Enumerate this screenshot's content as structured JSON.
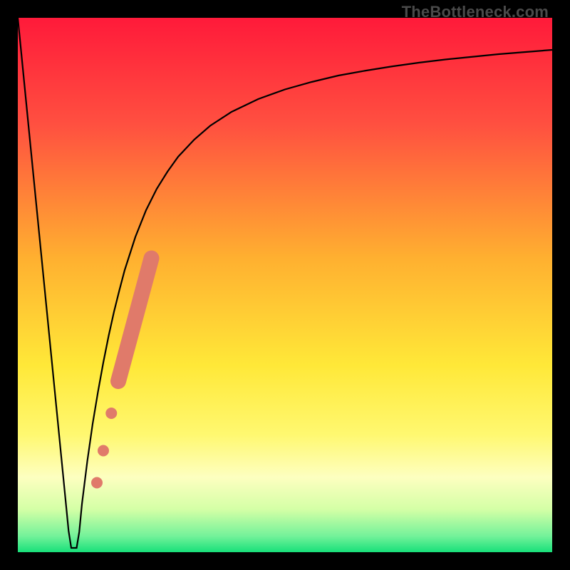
{
  "watermark": "TheBottleneck.com",
  "colors": {
    "frame": "#000000",
    "curve": "#000000",
    "marker_fill": "#e07a6a",
    "marker_stroke": "#cf6b5c",
    "gradient_stops": [
      {
        "offset": 0.0,
        "color": "#ff1a3a"
      },
      {
        "offset": 0.2,
        "color": "#ff5040"
      },
      {
        "offset": 0.45,
        "color": "#ffb030"
      },
      {
        "offset": 0.65,
        "color": "#ffe838"
      },
      {
        "offset": 0.78,
        "color": "#fff870"
      },
      {
        "offset": 0.86,
        "color": "#fdffc0"
      },
      {
        "offset": 0.92,
        "color": "#d4ffa6"
      },
      {
        "offset": 0.97,
        "color": "#73f29a"
      },
      {
        "offset": 1.0,
        "color": "#18e07a"
      }
    ]
  },
  "chart_data": {
    "type": "line",
    "title": "",
    "xlabel": "",
    "ylabel": "",
    "xlim": [
      0,
      100
    ],
    "ylim": [
      0,
      100
    ],
    "series": [
      {
        "name": "curve",
        "x": [
          0.0,
          1.0,
          2.0,
          3.0,
          4.0,
          5.0,
          6.0,
          7.0,
          8.0,
          9.0,
          9.5,
          10.0,
          10.5,
          11.0,
          11.5,
          12.0,
          13.0,
          14.0,
          15.0,
          16.0,
          17.0,
          18.0,
          19.0,
          20.0,
          22.0,
          24.0,
          26.0,
          28.0,
          30.0,
          33.0,
          36.0,
          40.0,
          45.0,
          50.0,
          55.0,
          60.0,
          65.0,
          70.0,
          75.0,
          80.0,
          85.0,
          90.0,
          95.0,
          100.0
        ],
        "values": [
          100.0,
          89.9,
          79.8,
          69.7,
          59.6,
          49.5,
          39.4,
          29.3,
          19.2,
          9.1,
          4.0,
          0.8,
          0.8,
          0.8,
          3.8,
          9.0,
          17.0,
          24.0,
          30.0,
          35.5,
          40.5,
          45.0,
          49.0,
          52.8,
          59.0,
          64.0,
          68.0,
          71.2,
          74.0,
          77.2,
          79.8,
          82.4,
          84.8,
          86.6,
          88.0,
          89.2,
          90.1,
          90.9,
          91.6,
          92.2,
          92.7,
          93.2,
          93.6,
          94.0
        ]
      }
    ],
    "markers": {
      "dots": [
        {
          "x": 14.8,
          "y": 13.0,
          "r": 8
        },
        {
          "x": 16.0,
          "y": 19.0,
          "r": 8
        },
        {
          "x": 17.5,
          "y": 26.0,
          "r": 8
        }
      ],
      "segment": {
        "x1": 18.8,
        "y1": 32.0,
        "x2": 25.0,
        "y2": 55.0,
        "width": 22
      }
    }
  }
}
